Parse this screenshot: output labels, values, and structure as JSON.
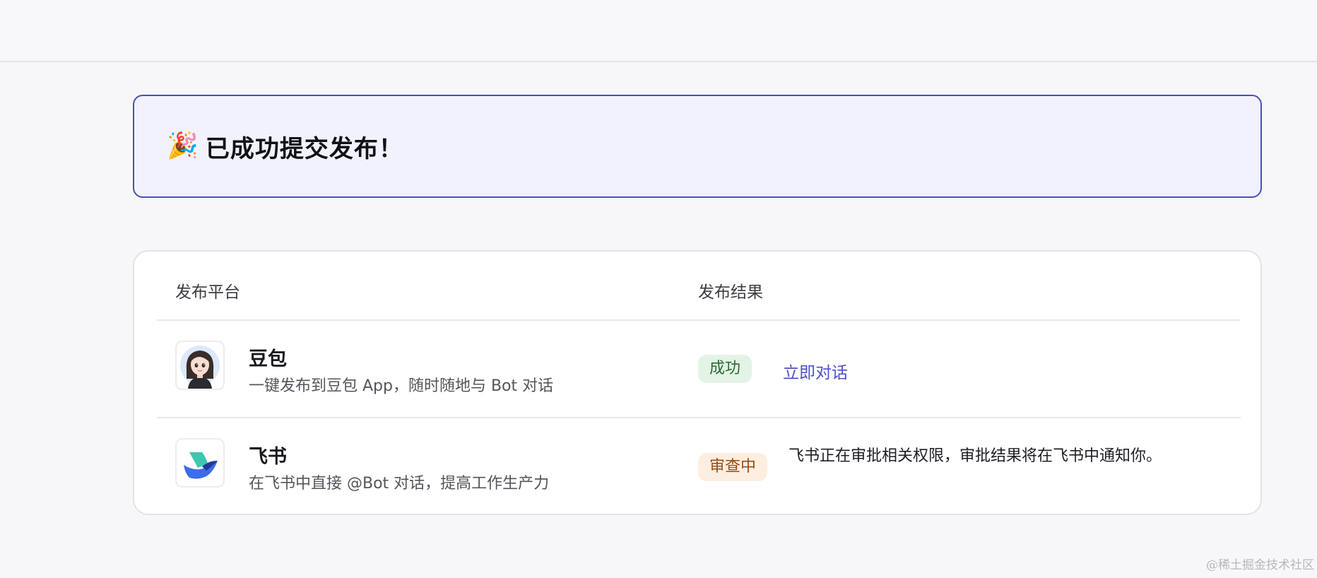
{
  "banner": {
    "emoji": "🎉",
    "title": "已成功提交发布！"
  },
  "table": {
    "headers": {
      "platform": "发布平台",
      "result": "发布结果"
    },
    "rows": [
      {
        "name": "豆包",
        "description": "一键发布到豆包 App，随时随地与 Bot 对话",
        "status": "成功",
        "action": "立即对话"
      },
      {
        "name": "飞书",
        "description": "在飞书中直接 @Bot 对话，提高工作生产力",
        "status": "审查中",
        "note": "飞书正在审批相关权限，审批结果将在飞书中通知你。"
      }
    ]
  },
  "watermark": "@稀土掘金技术社区",
  "colors": {
    "accent": "#4e4fc7",
    "banner_border": "#4b4fb8",
    "banner_bg": "#f1f2fd",
    "success_bg": "#e3f4e6",
    "success_text": "#2c6b35",
    "review_bg": "#fdeee0",
    "review_text": "#9a4d14"
  },
  "icons": {
    "banner": "party-popper-icon",
    "doubao": "doubao-avatar-logo",
    "feishu": "feishu-logo"
  }
}
